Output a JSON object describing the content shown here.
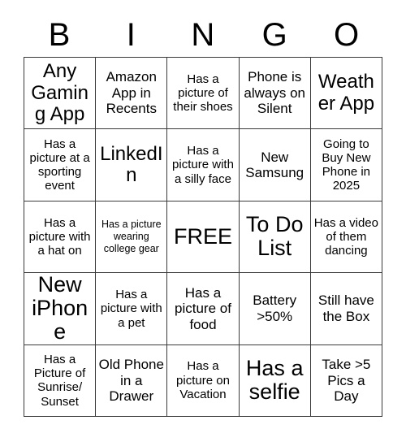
{
  "card": {
    "title": "BINGO",
    "header_letters": [
      "B",
      "I",
      "N",
      "G",
      "O"
    ],
    "grid_size": "5x5",
    "background_color": "#ffffff",
    "border_color": "#3a3a3a",
    "text_color": "#000000",
    "rows": [
      [
        {
          "text": "Any Gaming App",
          "size": "lg",
          "marked": false
        },
        {
          "text": "Amazon App in Recents",
          "size": "md",
          "marked": false
        },
        {
          "text": "Has a picture of their shoes",
          "size": "sm",
          "marked": false
        },
        {
          "text": "Phone is always on Silent",
          "size": "md",
          "marked": false
        },
        {
          "text": "Weather App",
          "size": "lg",
          "marked": false
        }
      ],
      [
        {
          "text": "Has a picture at a sporting event",
          "size": "sm",
          "marked": false
        },
        {
          "text": "LinkedIn",
          "size": "lg",
          "marked": false
        },
        {
          "text": "Has a picture with a silly face",
          "size": "sm",
          "marked": false
        },
        {
          "text": "New Samsung",
          "size": "md",
          "marked": false
        },
        {
          "text": "Going to Buy New Phone in 2025",
          "size": "sm",
          "marked": false
        }
      ],
      [
        {
          "text": "Has a picture with a hat on",
          "size": "sm",
          "marked": false
        },
        {
          "text": "Has a picture wearing college gear",
          "size": "xs",
          "marked": false
        },
        {
          "text": "FREE",
          "size": "xl",
          "marked": false
        },
        {
          "text": "To Do List",
          "size": "xl",
          "marked": false
        },
        {
          "text": "Has a video of them dancing",
          "size": "sm",
          "marked": false
        }
      ],
      [
        {
          "text": "New iPhone",
          "size": "xl",
          "marked": false
        },
        {
          "text": "Has a picture with a pet",
          "size": "sm",
          "marked": false
        },
        {
          "text": "Has a picture of food",
          "size": "md",
          "marked": false
        },
        {
          "text": "Battery >50%",
          "size": "md",
          "marked": false
        },
        {
          "text": "Still have the Box",
          "size": "md",
          "marked": false
        }
      ],
      [
        {
          "text": "Has a Picture of Sunrise/ Sunset",
          "size": "sm",
          "marked": false
        },
        {
          "text": "Old Phone in a Drawer",
          "size": "md",
          "marked": false
        },
        {
          "text": "Has a picture on Vacation",
          "size": "sm",
          "marked": false
        },
        {
          "text": "Has a selfie",
          "size": "xl",
          "marked": false
        },
        {
          "text": "Take >5 Pics a Day",
          "size": "md",
          "marked": false
        }
      ]
    ]
  }
}
